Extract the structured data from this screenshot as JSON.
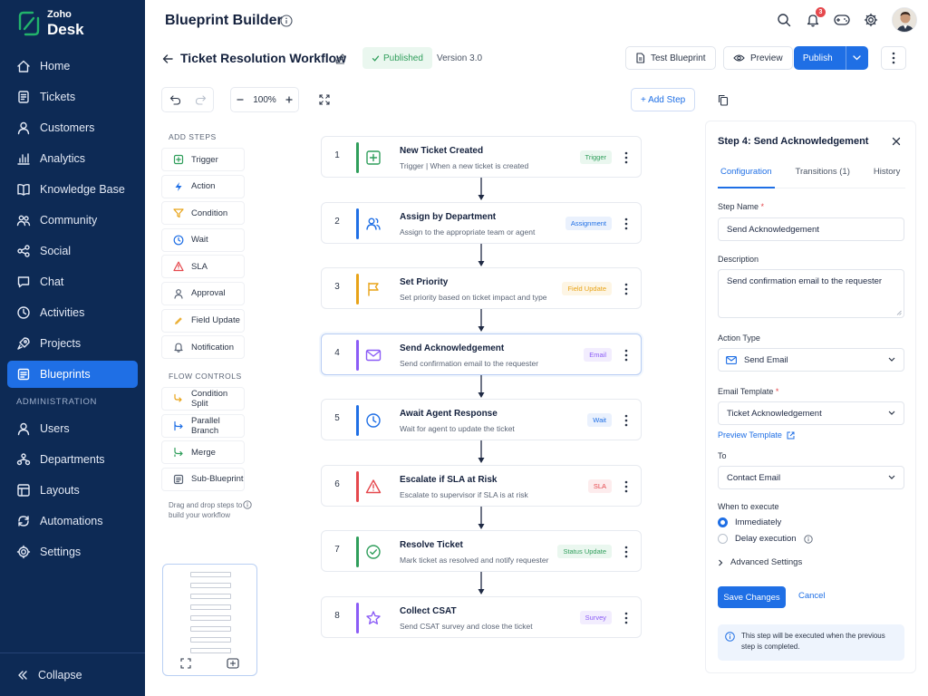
{
  "brand": {
    "line1": "Zoho",
    "line2": "Desk"
  },
  "nav": {
    "items": [
      {
        "label": "Home",
        "icon": "home-icon"
      },
      {
        "label": "Tickets",
        "icon": "tickets-icon"
      },
      {
        "label": "Customers",
        "icon": "customers-icon"
      },
      {
        "label": "Analytics",
        "icon": "analytics-icon"
      },
      {
        "label": "Knowledge Base",
        "icon": "book-icon"
      },
      {
        "label": "Community",
        "icon": "community-icon"
      },
      {
        "label": "Social",
        "icon": "share-icon"
      },
      {
        "label": "Chat",
        "icon": "chat-icon"
      },
      {
        "label": "Activities",
        "icon": "clock-icon"
      },
      {
        "label": "Projects",
        "icon": "rocket-icon"
      },
      {
        "label": "Blueprints",
        "icon": "blueprint-icon",
        "active": true
      }
    ],
    "section": "ADMINISTRATION",
    "admin_items": [
      {
        "label": "Users",
        "icon": "user-icon"
      },
      {
        "label": "Departments",
        "icon": "departments-icon"
      },
      {
        "label": "Layouts",
        "icon": "layouts-icon"
      },
      {
        "label": "Automations",
        "icon": "automations-icon"
      },
      {
        "label": "Settings",
        "icon": "gear-icon"
      }
    ],
    "collapse": "Collapse"
  },
  "header": {
    "title": "Blueprint Builder",
    "notification_count": "3"
  },
  "workflow": {
    "title": "Ticket Resolution Workflow",
    "status": "Published",
    "version": "Version 3.0",
    "test_label": "Test Blueprint",
    "preview_label": "Preview",
    "publish_label": "Publish"
  },
  "toolbar": {
    "zoom": "100%",
    "add_step": "+ Add Step"
  },
  "palette": {
    "add_title": "ADD STEPS",
    "add_items": [
      {
        "label": "Trigger",
        "icon": "trigger-icon",
        "color": "#2f9e5b"
      },
      {
        "label": "Action",
        "icon": "bolt-icon",
        "color": "#1f6fe5"
      },
      {
        "label": "Condition",
        "icon": "filter-icon",
        "color": "#e8a317"
      },
      {
        "label": "Wait",
        "icon": "clock-icon",
        "color": "#1f6fe5"
      },
      {
        "label": "SLA",
        "icon": "warning-icon",
        "color": "#e5484d"
      },
      {
        "label": "Approval",
        "icon": "approval-icon",
        "color": "#5b6576"
      },
      {
        "label": "Field Update",
        "icon": "pencil-icon",
        "color": "#e8a317"
      },
      {
        "label": "Notification",
        "icon": "bell-icon",
        "color": "#5b6576"
      }
    ],
    "flow_title": "FLOW CONTROLS",
    "flow_items": [
      {
        "label": "Condition Split",
        "icon": "split-icon",
        "color": "#e8a317"
      },
      {
        "label": "Parallel Branch",
        "icon": "branch-icon",
        "color": "#1f6fe5"
      },
      {
        "label": "Merge",
        "icon": "merge-icon",
        "color": "#2f9e5b"
      },
      {
        "label": "Sub-Blueprint",
        "icon": "subblueprint-icon",
        "color": "#5b6576"
      }
    ],
    "hint": "Drag and drop steps to build your workflow"
  },
  "steps": [
    {
      "num": "1",
      "title": "New Ticket Created",
      "desc": "Trigger  |  When a new ticket is created",
      "tag": "Trigger",
      "color": "#2f9e5b",
      "tag_bg": "#eaf7ef",
      "icon": "plus-square-icon"
    },
    {
      "num": "2",
      "title": "Assign by Department",
      "desc": "Assign to the appropriate team or agent",
      "tag": "Assignment",
      "color": "#1f6fe5",
      "tag_bg": "#eaf1fd",
      "icon": "people-icon"
    },
    {
      "num": "3",
      "title": "Set Priority",
      "desc": "Set priority based on ticket impact and type",
      "tag": "Field Update",
      "color": "#e8a317",
      "tag_bg": "#fdf5e4",
      "icon": "flag-icon"
    },
    {
      "num": "4",
      "title": "Send Acknowledgement",
      "desc": "Send confirmation email to the requester",
      "tag": "Email",
      "color": "#8b5cf6",
      "tag_bg": "#f2edfe",
      "icon": "mail-icon",
      "active": true
    },
    {
      "num": "5",
      "title": "Await Agent Response",
      "desc": "Wait for agent to update the ticket",
      "tag": "Wait",
      "color": "#1f6fe5",
      "tag_bg": "#eaf1fd",
      "icon": "clock-icon"
    },
    {
      "num": "6",
      "title": "Escalate if SLA at Risk",
      "desc": "Escalate to supervisor if SLA is at risk",
      "tag": "SLA",
      "color": "#e5484d",
      "tag_bg": "#fdeced",
      "icon": "warning-icon"
    },
    {
      "num": "7",
      "title": "Resolve Ticket",
      "desc": "Mark ticket as resolved and notify requester",
      "tag": "Status Update",
      "color": "#2f9e5b",
      "tag_bg": "#eaf7ef",
      "icon": "check-circle-icon"
    },
    {
      "num": "8",
      "title": "Collect CSAT",
      "desc": "Send CSAT survey and close the ticket",
      "tag": "Survey",
      "color": "#8b5cf6",
      "tag_bg": "#f2edfe",
      "icon": "star-icon"
    }
  ],
  "panel": {
    "title": "Step 4: Send Acknowledgement",
    "tabs": [
      "Configuration",
      "Transitions (1)",
      "History"
    ],
    "step_name_label": "Step Name",
    "step_name": "Send Acknowledgement",
    "description_label": "Description",
    "description": "Send confirmation email to the requester",
    "action_type_label": "Action Type",
    "action_type": "Send Email",
    "email_template_label": "Email Template",
    "email_template": "Ticket Acknowledgement",
    "preview_template": "Preview Template",
    "to_label": "To",
    "to": "Contact Email",
    "when_label": "When to execute",
    "when_options": [
      "Immediately",
      "Delay execution"
    ],
    "advanced": "Advanced Settings",
    "save": "Save Changes",
    "cancel": "Cancel",
    "note": "This step will be executed when the previous step is completed."
  }
}
